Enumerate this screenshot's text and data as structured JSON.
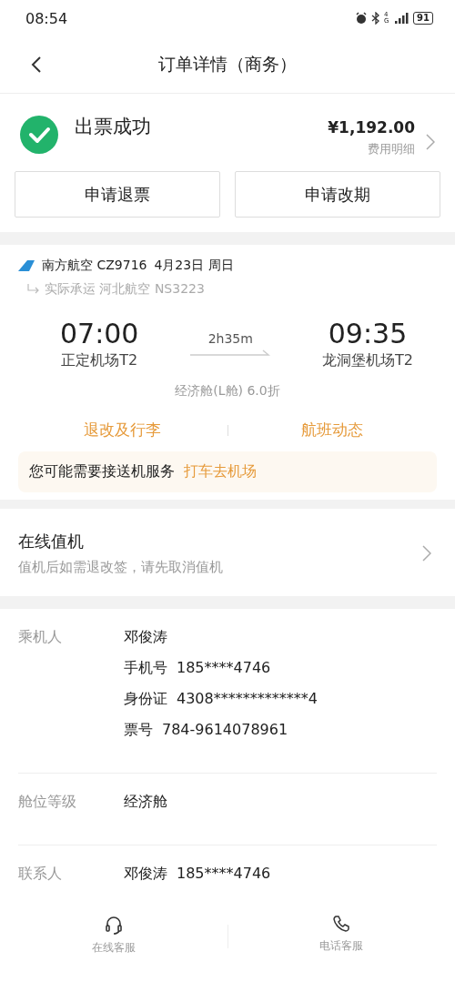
{
  "status_bar": {
    "time": "08:54",
    "network": "4G",
    "battery": "91"
  },
  "nav": {
    "title": "订单详情（商务）"
  },
  "order": {
    "status": "出票成功",
    "price": "¥1,192.00",
    "price_link": "费用明细",
    "buttons": [
      "申请退票",
      "申请改期"
    ]
  },
  "flight": {
    "airline": "南方航空 CZ9716",
    "date": "4月23日 周日",
    "operated_by": "实际承运 河北航空 NS3223",
    "depart": {
      "time": "07:00",
      "airport": "正定机场T2"
    },
    "duration": "2h35m",
    "arrive": {
      "time": "09:35",
      "airport": "龙洞堡机场T2"
    },
    "cabin": "经济舱(L舱) 6.0折",
    "links": [
      "退改及行李",
      "航班动态"
    ],
    "transfer": {
      "text": "您可能需要接送机服务",
      "link": "打车去机场"
    }
  },
  "checkin": {
    "title": "在线值机",
    "subtitle": "值机后如需退改签，请先取消值机"
  },
  "details": [
    {
      "label": "乘机人",
      "lines": [
        {
          "value": "邓俊涛"
        },
        {
          "key": "手机号",
          "value": "185****4746"
        },
        {
          "key": "身份证",
          "value": "4308*************4"
        },
        {
          "key": "票号",
          "value": "784-9614078961"
        }
      ]
    },
    {
      "label": "舱位等级",
      "lines": [
        {
          "value": "经济舱"
        }
      ]
    },
    {
      "label": "联系人",
      "lines": [
        {
          "key": "邓俊涛",
          "value": "185****4746"
        }
      ]
    }
  ],
  "bottom_bar": [
    {
      "kind": "headset",
      "label": "在线客服"
    },
    {
      "kind": "phone",
      "label": "电话客服"
    }
  ]
}
